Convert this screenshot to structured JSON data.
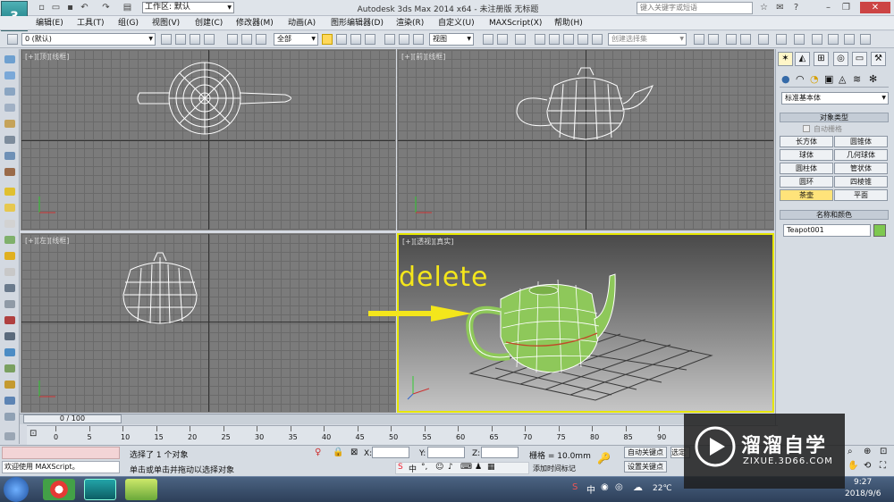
{
  "titlebar": {
    "app_button": "3",
    "workspace": "工作区: 默认",
    "title": "Autodesk 3ds Max  2014 x64    - 未注册版   无标题",
    "search_placeholder": "键入关键字或短语"
  },
  "menu": [
    "编辑(E)",
    "工具(T)",
    "组(G)",
    "视图(V)",
    "创建(C)",
    "修改器(M)",
    "动画(A)",
    "图形编辑器(D)",
    "渲染(R)",
    "自定义(U)",
    "MAXScript(X)",
    "帮助(H)"
  ],
  "toolbar": {
    "layer": "0 (默认)",
    "filter": "全部",
    "coord": "视图",
    "named_selection": "创建选择集"
  },
  "viewports": {
    "top": {
      "label": "[+][顶][线框]"
    },
    "front": {
      "label": "[+][前][线框]"
    },
    "left": {
      "label": "[+][左][线框]"
    },
    "persp": {
      "label": "[+][透视][真实]"
    }
  },
  "annotation": {
    "text": "delete",
    "color": "#f4e61b"
  },
  "command_panel": {
    "category": "标准基本体",
    "object_type_title": "对象类型",
    "autogrid": "自动栅格",
    "buttons": [
      "长方体",
      "圆锥体",
      "球体",
      "几何球体",
      "圆柱体",
      "管状体",
      "圆环",
      "四棱锥",
      "茶壶",
      "平面"
    ],
    "name_color_title": "名称和颜色",
    "object_name": "Teapot001",
    "object_color": "#7ec850"
  },
  "timeline": {
    "frame": "0 / 100",
    "ticks": [
      "0",
      "5",
      "10",
      "15",
      "20",
      "25",
      "30",
      "35",
      "40",
      "45",
      "50",
      "55",
      "60",
      "65",
      "70",
      "75",
      "80",
      "85",
      "90"
    ]
  },
  "status": {
    "listener": "欢迎使用 MAXScript。",
    "selected": "选择了 1 个对象",
    "prompt": "单击或单击并拖动以选择对象",
    "x_label": "X:",
    "y_label": "Y:",
    "z_label": "Z:",
    "grid": "栅格 = 10.0mm",
    "auto_key": "自动关键点",
    "set_key": "设置关键点",
    "selected_short": "选定",
    "add_time_tag": "添加时间标记"
  },
  "tray": {
    "temp": "22℃",
    "time": "9:27",
    "date": "2018/9/6"
  },
  "watermark": {
    "brand": "溜溜自学",
    "url": "ZIXUE.3D66.COM"
  }
}
